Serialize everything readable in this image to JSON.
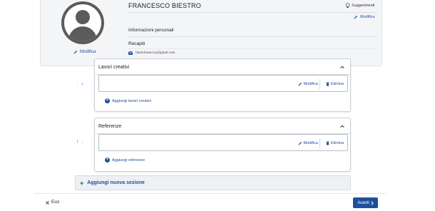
{
  "profile": {
    "name": "FRANCESCO BIESTRO",
    "avatar_edit_label": "Modifica",
    "suggestions_label": "Suggerimenti",
    "edit_label": "Modifica",
    "personal_info_label": "Informazioni personali",
    "contacts_label": "Recapiti",
    "email": "fantiniliusecco@gmail.com"
  },
  "sections": [
    {
      "title": "Lavori creativi",
      "entry_edit_label": "Modifica",
      "entry_delete_label": "Elimina",
      "add_label": "Aggiungi lavori creativi"
    },
    {
      "title": "Referenze",
      "entry_edit_label": "Modifica",
      "entry_delete_label": "Elimina",
      "add_label": "Aggiungi referenze"
    }
  ],
  "add_section_label": "Aggiungi nuova sezione",
  "footer": {
    "exit_label": "Esci",
    "next_label": "Avanti"
  },
  "colors": {
    "accent": "#1f4f9c",
    "card_bg": "#f4f5f7",
    "border": "#c9ced6"
  }
}
